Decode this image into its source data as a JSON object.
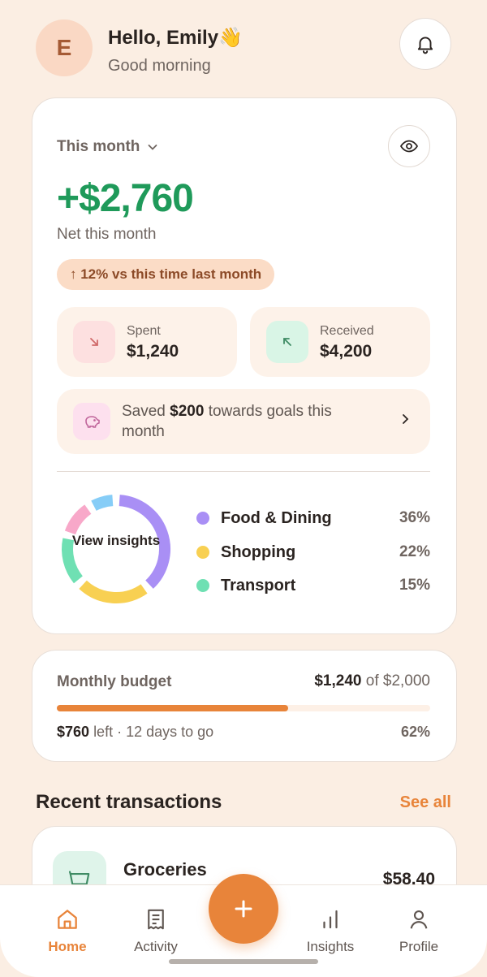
{
  "header": {
    "avatar_initial": "E",
    "greeting": "Hello, Emily👋",
    "subtitle": "Good morning"
  },
  "summary": {
    "period_label": "This month",
    "net_amount": "+$2,760",
    "net_label": "Net this month",
    "trend_label": "↑ 12% vs this time last month",
    "spent": {
      "label": "Spent",
      "value": "$1,240"
    },
    "received": {
      "label": "Received",
      "value": "$4,200"
    },
    "savings": {
      "prefix": "Saved ",
      "amount": "$200",
      "suffix": " towards goals this month"
    },
    "insights_label": "View insights",
    "categories": [
      {
        "name": "Food & Dining",
        "percent": "36%",
        "color": "#a98ff5"
      },
      {
        "name": "Shopping",
        "percent": "22%",
        "color": "#f8d052"
      },
      {
        "name": "Transport",
        "percent": "15%",
        "color": "#6fe0b3"
      }
    ],
    "donut_segments": [
      {
        "color": "#a98ff5",
        "share": 36
      },
      {
        "color": "#f8d052",
        "share": 22
      },
      {
        "color": "#6fe0b3",
        "share": 15
      },
      {
        "color": "#f8a8c9",
        "share": 11
      },
      {
        "color": "#86cdf7",
        "share": 8
      }
    ]
  },
  "budget": {
    "title": "Monthly budget",
    "spent": "$1,240",
    "of_total": "of $2,000",
    "left_amount": "$760",
    "left_suffix": "left · 12 days to go",
    "percent": "62%",
    "progress": 0.62
  },
  "transactions": {
    "title": "Recent transactions",
    "see_all": "See all",
    "items": [
      {
        "name": "Groceries",
        "amount": "$58.40",
        "icon": "basket-icon"
      }
    ]
  },
  "nav": {
    "items": [
      {
        "label": "Home",
        "icon": "home-icon",
        "active": true
      },
      {
        "label": "Activity",
        "icon": "receipt-icon"
      },
      {
        "label": "Insights",
        "icon": "bar-chart-icon"
      },
      {
        "label": "Profile",
        "icon": "profile-icon"
      }
    ],
    "fab_icon": "plus-icon"
  },
  "colors": {
    "accent": "#e8843a",
    "positive": "#1f9a5a",
    "background": "#fbeee3"
  }
}
